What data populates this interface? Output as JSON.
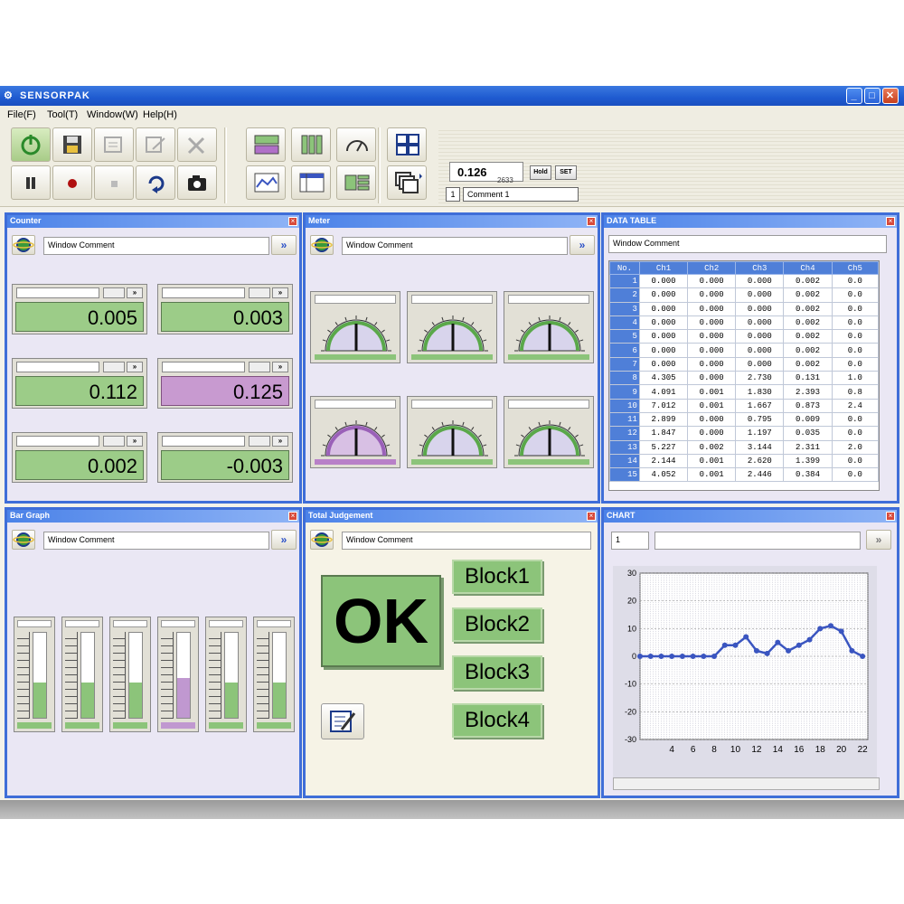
{
  "window": {
    "title": "SENSORPAK",
    "app_icon": "sensor-app-icon"
  },
  "menu": [
    "File(F)",
    "Tool(T)",
    "Window(W)",
    "Help(H)"
  ],
  "toolbar": {
    "readout": "0.126",
    "readout_unit": "2633",
    "hold_label": "Hold",
    "set_label": "SET",
    "comment_no": "1",
    "comment": "Comment 1"
  },
  "panels": {
    "counter": {
      "title": "Counter",
      "comment": "Window Comment"
    },
    "meter": {
      "title": "Meter",
      "comment": "Window Comment"
    },
    "data_table": {
      "title": "DATA TABLE",
      "comment": "Window Comment"
    },
    "bar_graph": {
      "title": "Bar Graph",
      "comment": "Window Comment"
    },
    "judgement": {
      "title": "Total Judgement",
      "comment": "Window Comment"
    },
    "chart": {
      "title": "CHART",
      "field": "1"
    }
  },
  "counters": [
    {
      "value": "0.005",
      "highlight": false
    },
    {
      "value": "0.003",
      "highlight": false
    },
    {
      "value": "0.112",
      "highlight": false
    },
    {
      "value": "0.125",
      "highlight": true
    },
    {
      "value": "0.002",
      "highlight": false
    },
    {
      "value": "-0.003",
      "highlight": false
    }
  ],
  "meters": [
    {
      "level": 0.5,
      "highlight": false
    },
    {
      "level": 0.5,
      "highlight": false
    },
    {
      "level": 0.5,
      "highlight": false
    },
    {
      "level": 0.5,
      "highlight": true
    },
    {
      "level": 0.5,
      "highlight": false
    },
    {
      "level": 0.5,
      "highlight": false
    }
  ],
  "table": {
    "headers": [
      "No.",
      "Ch1",
      "Ch2",
      "Ch3",
      "Ch4",
      "Ch5"
    ],
    "rows": [
      [
        "1",
        "0.000",
        "0.000",
        "0.000",
        "0.002",
        "0.0"
      ],
      [
        "2",
        "0.000",
        "0.000",
        "0.000",
        "0.002",
        "0.0"
      ],
      [
        "3",
        "0.000",
        "0.000",
        "0.000",
        "0.002",
        "0.0"
      ],
      [
        "4",
        "0.000",
        "0.000",
        "0.000",
        "0.002",
        "0.0"
      ],
      [
        "5",
        "0.000",
        "0.000",
        "0.000",
        "0.002",
        "0.0"
      ],
      [
        "6",
        "0.000",
        "0.000",
        "0.000",
        "0.002",
        "0.0"
      ],
      [
        "7",
        "0.000",
        "0.000",
        "0.000",
        "0.002",
        "0.0"
      ],
      [
        "8",
        "4.305",
        "0.000",
        "2.730",
        "0.131",
        "1.0"
      ],
      [
        "9",
        "4.091",
        "0.001",
        "1.830",
        "2.393",
        "0.8"
      ],
      [
        "10",
        "7.012",
        "0.001",
        "1.667",
        "0.873",
        "2.4"
      ],
      [
        "11",
        "2.899",
        "0.000",
        "0.795",
        "0.009",
        "0.0"
      ],
      [
        "12",
        "1.847",
        "0.000",
        "1.197",
        "0.035",
        "0.0"
      ],
      [
        "13",
        "5.227",
        "0.002",
        "3.144",
        "2.311",
        "2.0"
      ],
      [
        "14",
        "2.144",
        "0.001",
        "2.620",
        "1.399",
        "0.0"
      ],
      [
        "15",
        "4.052",
        "0.001",
        "2.446",
        "0.384",
        "0.0"
      ]
    ]
  },
  "bars": [
    {
      "level": 0.42,
      "highlight": false
    },
    {
      "level": 0.42,
      "highlight": false
    },
    {
      "level": 0.42,
      "highlight": false
    },
    {
      "level": 0.47,
      "highlight": true
    },
    {
      "level": 0.42,
      "highlight": false
    },
    {
      "level": 0.42,
      "highlight": false
    }
  ],
  "judgement": {
    "result": "OK",
    "blocks": [
      "Block1",
      "Block2",
      "Block3",
      "Block4"
    ]
  },
  "chart_data": {
    "type": "line",
    "x": [
      1,
      2,
      3,
      4,
      5,
      6,
      7,
      8,
      9,
      10,
      11,
      12,
      13,
      14,
      15,
      16,
      17,
      18,
      19,
      20,
      21,
      22
    ],
    "series": [
      {
        "values": [
          0,
          0,
          0,
          0,
          0,
          0,
          0,
          0,
          4,
          4,
          7,
          2,
          1,
          5,
          2,
          4,
          6,
          10,
          11,
          9,
          2,
          0
        ]
      }
    ],
    "xticks": [
      4,
      6,
      8,
      10,
      12,
      14,
      16,
      18,
      20,
      22
    ],
    "yticks": [
      30,
      20,
      10,
      0,
      -10,
      -20,
      -30
    ],
    "xlim": [
      1,
      22.5
    ],
    "ylim": [
      -30,
      30
    ],
    "grid": true,
    "color": "#3a55c0"
  }
}
